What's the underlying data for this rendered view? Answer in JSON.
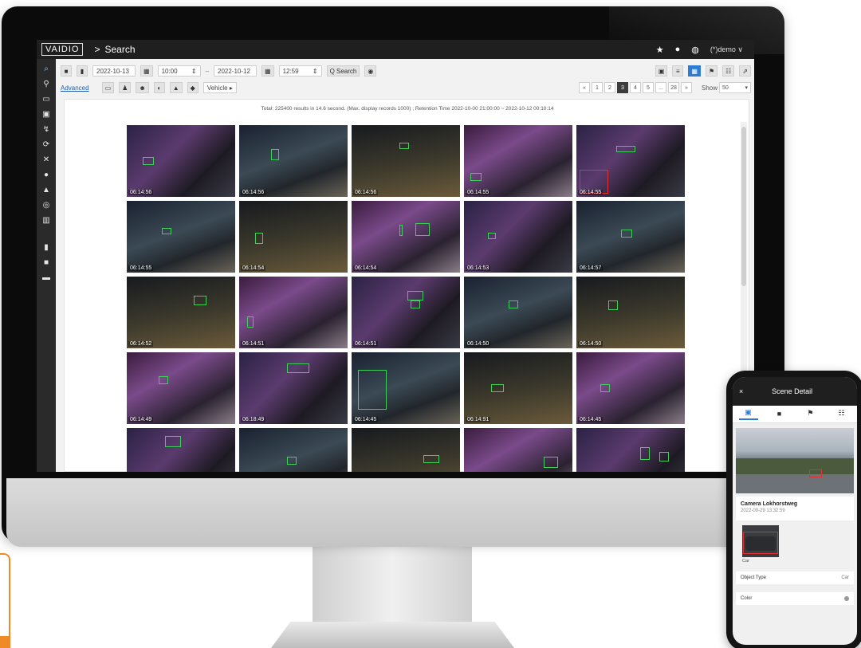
{
  "app": {
    "logo": "VAIDIO",
    "breadcrumb_sep": ">",
    "page": "Search",
    "user": "(*)demo ∨"
  },
  "topbar_icons": [
    "pin-icon",
    "info-icon",
    "globe-icon"
  ],
  "sidebar": [
    "search-icon",
    "person-icon",
    "vehicle-icon",
    "face-icon",
    "line-crossing-icon",
    "loitering-icon",
    "intrusion-icon",
    "alert-icon",
    "bell-icon",
    "camera-scan-icon",
    "stats-icon",
    "document-icon",
    "video-icon",
    "device-icon"
  ],
  "filters": {
    "start_date": "2022-10-13",
    "start_time": "10:00",
    "end_date": "2022-10-12",
    "end_time": "12:59",
    "search_label": "Q Search",
    "advanced_label": "Advanced",
    "vehicle_select": "Vehicle ▸"
  },
  "pager": {
    "prev": "«",
    "pages": [
      "1",
      "2",
      "3",
      "4",
      "5",
      "...",
      "28"
    ],
    "current": "3",
    "next": "»",
    "show_label": "Show",
    "show_value": "50"
  },
  "summary": "Total: 225400 results in 14.6 second. (Max. display records 1000) ; Retention Time 2022-10-00 21:00:00 ~ 2022-10-12 00:10:14",
  "thumbnails": [
    {
      "ts": "06:14:56"
    },
    {
      "ts": "06:14:56"
    },
    {
      "ts": "06:14:56"
    },
    {
      "ts": "06:14:55"
    },
    {
      "ts": "06:14:55"
    },
    {
      "ts": "06:14:55"
    },
    {
      "ts": "06:14:54"
    },
    {
      "ts": "06:14:54"
    },
    {
      "ts": "06:14:53"
    },
    {
      "ts": "06:14:57"
    },
    {
      "ts": "06:14:52"
    },
    {
      "ts": "06:14:51"
    },
    {
      "ts": "06:14:51"
    },
    {
      "ts": "06:14:50"
    },
    {
      "ts": "06:14:50"
    },
    {
      "ts": "06:14:49"
    },
    {
      "ts": "06:18:49"
    },
    {
      "ts": "06:14:45"
    },
    {
      "ts": "06:14:91"
    },
    {
      "ts": "06:14:45"
    },
    {
      "ts": ""
    },
    {
      "ts": ""
    },
    {
      "ts": ""
    },
    {
      "ts": ""
    },
    {
      "ts": ""
    }
  ],
  "phone": {
    "close": "×",
    "title": "Scene Detail",
    "camera": "Camera Lokhorstweg",
    "timestamp": "2022-09-29 13:32:59",
    "object_label": "Car",
    "object_type_label": "Object Type",
    "object_type_value": "Car",
    "color_label": "Color"
  }
}
